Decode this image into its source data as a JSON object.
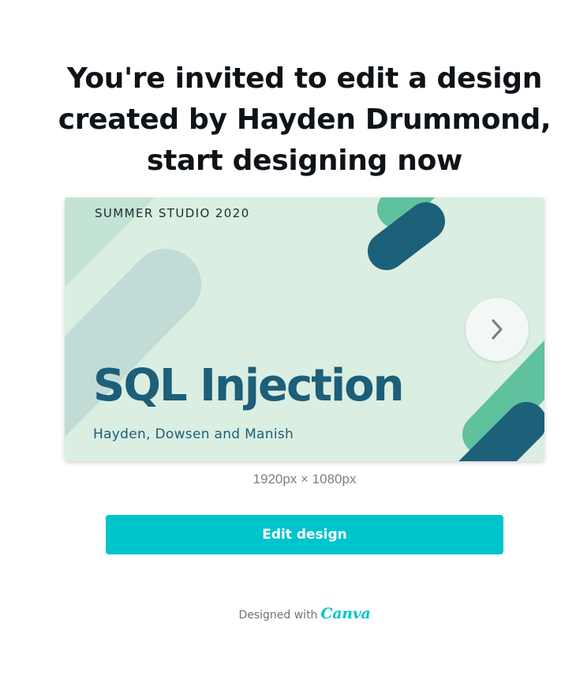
{
  "invite": {
    "line1": "You're invited to edit a design",
    "line2": "created by Hayden Drummond,",
    "line3": "start designing now"
  },
  "preview": {
    "studio_label": "SUMMER STUDIO 2020",
    "title": "SQL Injection",
    "authors": "Hayden, Dowsen and Manish",
    "next_icon": "chevron-right-icon",
    "colors": {
      "background": "#daeee2",
      "title": "#1d5e78",
      "accent_green": "#5fc19e",
      "accent_navy": "#1d6079"
    }
  },
  "design": {
    "dimensions": "1920px × 1080px"
  },
  "actions": {
    "edit_label": "Edit design",
    "edit_color": "#00c4cc"
  },
  "footer": {
    "designed_with": "Designed with",
    "brand": "Canva"
  }
}
